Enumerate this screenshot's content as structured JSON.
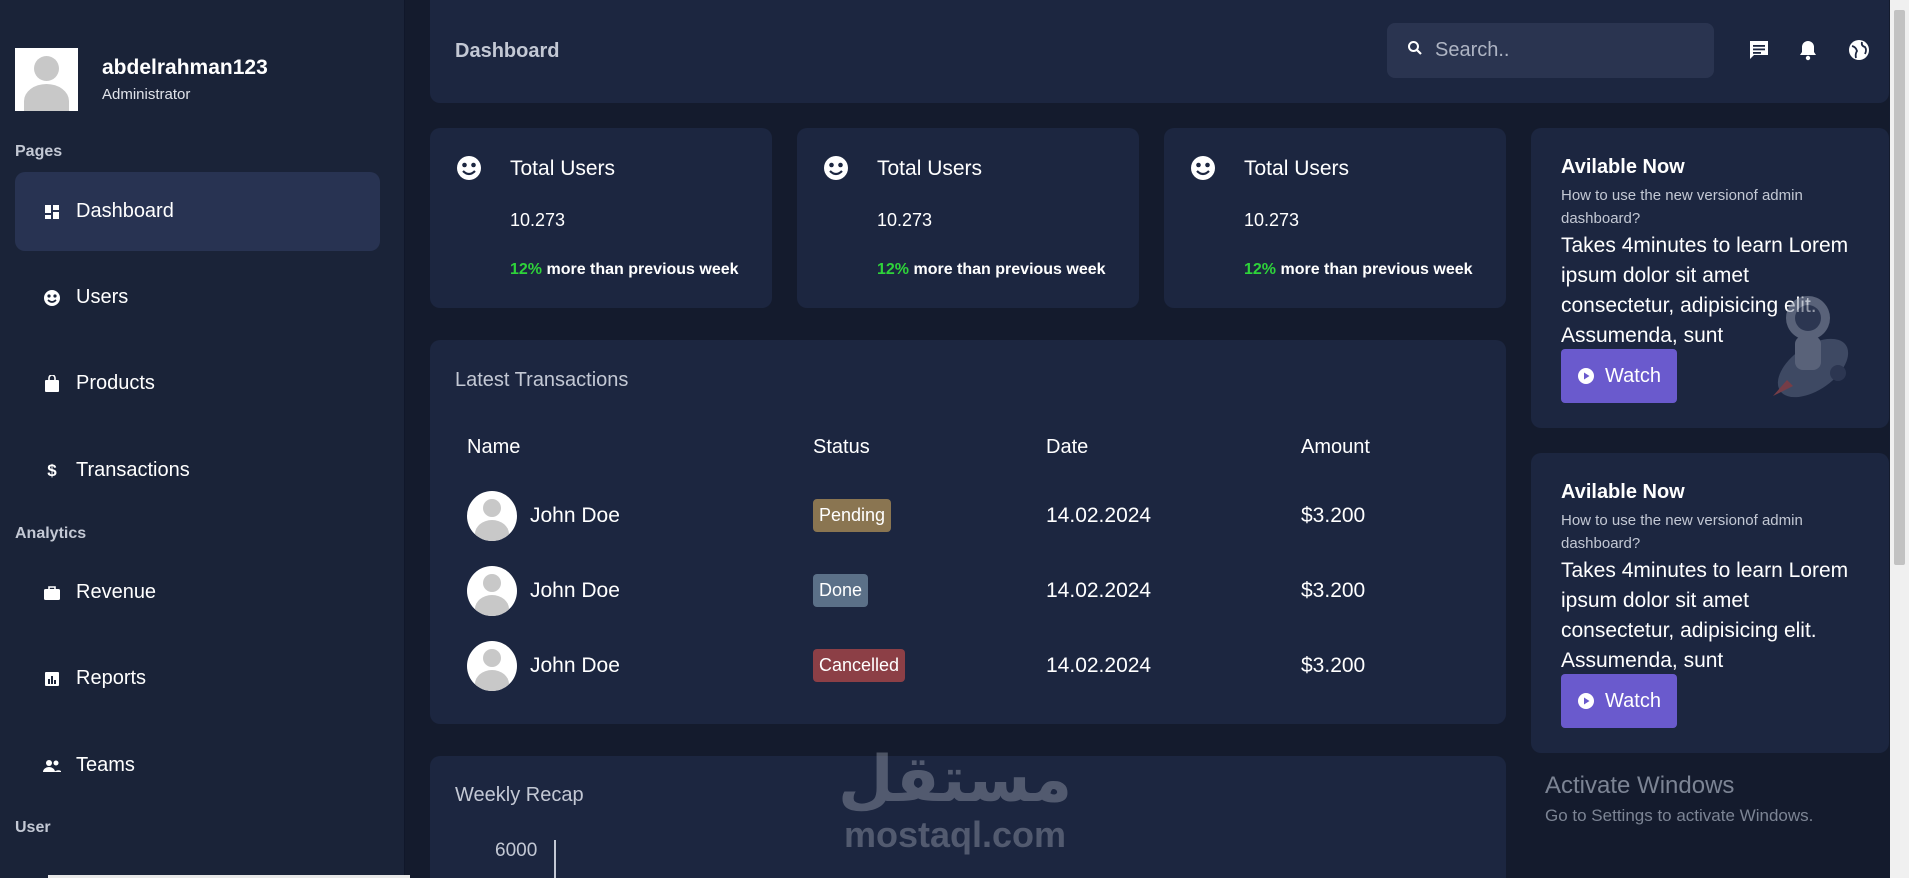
{
  "profile": {
    "name": "abdelrahman123",
    "role": "Administrator"
  },
  "sidebar": {
    "sections": [
      {
        "label": "Pages"
      },
      {
        "label": "Analytics"
      },
      {
        "label": "User"
      }
    ],
    "items": [
      {
        "label": "Dashboard",
        "icon": "dashboard-icon",
        "active": true
      },
      {
        "label": "Users",
        "icon": "users-icon"
      },
      {
        "label": "Products",
        "icon": "bag-icon"
      },
      {
        "label": "Transactions",
        "icon": "dollar-icon"
      },
      {
        "label": "Revenue",
        "icon": "briefcase-icon"
      },
      {
        "label": "Reports",
        "icon": "reports-icon"
      },
      {
        "label": "Teams",
        "icon": "teams-icon"
      }
    ]
  },
  "header": {
    "title": "Dashboard",
    "search_placeholder": "Search.."
  },
  "stats": [
    {
      "title": "Total Users",
      "value": "10.273",
      "pct": "12%",
      "note": " more than previous week"
    },
    {
      "title": "Total Users",
      "value": "10.273",
      "pct": "12%",
      "note": " more than previous week"
    },
    {
      "title": "Total Users",
      "value": "10.273",
      "pct": "12%",
      "note": " more than previous week"
    }
  ],
  "transactions": {
    "title": "Latest Transactions",
    "columns": [
      "Name",
      "Status",
      "Date",
      "Amount"
    ],
    "rows": [
      {
        "name": "John Doe",
        "status": "Pending",
        "date": "14.02.2024",
        "amount": "$3.200"
      },
      {
        "name": "John Doe",
        "status": "Done",
        "date": "14.02.2024",
        "amount": "$3.200"
      },
      {
        "name": "John Doe",
        "status": "Cancelled",
        "date": "14.02.2024",
        "amount": "$3.200"
      }
    ]
  },
  "weekly": {
    "title": "Weekly Recap",
    "y_tick": "6000"
  },
  "promos": [
    {
      "title": "Avilable Now",
      "subtitle": "How to use the new versionof admin dashboard?",
      "body": "Takes 4minutes to learn Lorem ipsum dolor sit amet consectetur, adipisicing elit. Assumenda, sunt",
      "button": "Watch"
    },
    {
      "title": "Avilable Now",
      "subtitle": "How to use the new versionof admin dashboard?",
      "body": "Takes 4minutes to learn Lorem ipsum dolor sit amet consectetur, adipisicing elit. Assumenda, sunt",
      "button": "Watch"
    }
  ],
  "overlay": {
    "activate_title": "Activate Windows",
    "activate_sub": "Go to Settings to activate Windows.",
    "watermark_ar": "مستقل",
    "watermark_en": "mostaql.com"
  },
  "colors": {
    "background": "#141b2d",
    "card": "#1c2640",
    "sidebar": "#1a2338",
    "accent": "#6a5acd",
    "positive": "#2ed33a",
    "pending": "#8a7551",
    "done": "#5b7088",
    "cancelled": "#8c3f46"
  }
}
